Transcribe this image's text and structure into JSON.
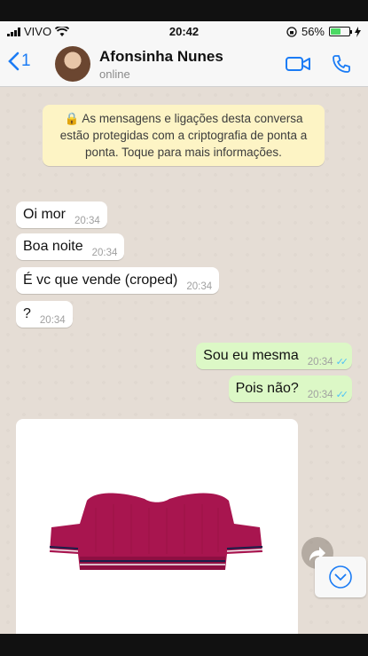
{
  "status": {
    "carrier": "VIVO",
    "time": "20:42",
    "battery": "56%",
    "battery_level": 0.56
  },
  "header": {
    "back_count": "1",
    "contact_name": "Afonsinha Nunes",
    "presence": "online"
  },
  "encryption_notice": "🔒 As mensagens e ligações desta conversa estão protegidas com a criptografia de ponta a ponta. Toque para mais informações.",
  "messages": [
    {
      "text": "Oi mor",
      "time": "20:34"
    },
    {
      "text": "Boa noite",
      "time": "20:34"
    },
    {
      "text": "É vc que vende (croped)",
      "time": "20:34"
    },
    {
      "text": "?",
      "time": "20:34"
    },
    {
      "text": "Sou eu mesma",
      "time": "20:34"
    },
    {
      "text": "Pois não?",
      "time": "20:34"
    }
  ],
  "ticks": "✓✓",
  "icons": [
    "signal-icon",
    "wifi-icon",
    "lock-rotation-icon",
    "battery-icon",
    "charging-icon",
    "back-chevron-icon",
    "video-call-icon",
    "phone-icon",
    "forward-icon",
    "chevron-down-icon"
  ],
  "colors": {
    "accent": "#1b7cf5",
    "outgoing": "#dcf8c6",
    "notice": "#fdf4c5",
    "ticks": "#4fc3f7",
    "product": "#a8154f"
  }
}
